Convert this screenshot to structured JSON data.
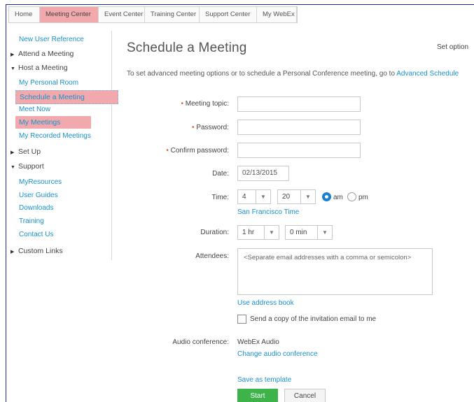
{
  "tabs": [
    "Home",
    "Meeting Center",
    "Event Center",
    "Training Center",
    "Support Center",
    "My WebEx"
  ],
  "sidebar": {
    "new_user_reference": "New User Reference",
    "attend_meeting": "Attend a Meeting",
    "host_meeting": "Host a Meeting",
    "my_personal_room": "My Personal Room",
    "schedule_meeting": "Schedule a Meeting",
    "meet_now": "Meet Now",
    "my_meetings": "My Meetings",
    "my_recorded_meetings": "My Recorded Meetings",
    "set_up": "Set Up",
    "support": "Support",
    "my_resources": "MyResources",
    "user_guides": "User Guides",
    "downloads": "Downloads",
    "training": "Training",
    "contact_us": "Contact Us",
    "custom_links": "Custom Links"
  },
  "main": {
    "title": "Schedule a Meeting",
    "set_options": "Set option",
    "intro_text": "To set advanced meeting options or to schedule a Personal Conference meeting, go to ",
    "intro_link": "Advanced Schedule",
    "form": {
      "topic_label": "Meeting topic:",
      "password_label": "Password:",
      "confirm_label": "Confirm password:",
      "date_label": "Date:",
      "date_value": "02/13/2015",
      "time_label": "Time:",
      "hour_value": "4",
      "minute_value": "20",
      "am_label": "am",
      "pm_label": "pm",
      "timezone_link": "San Francisco Time",
      "duration_label": "Duration:",
      "duration_hr": "1 hr",
      "duration_min": "0 min",
      "attendees_label": "Attendees:",
      "attendees_placeholder": "<Separate email addresses with a comma or semicolon>",
      "address_book_link": "Use address book",
      "copy_label": "Send a copy of the invitation email to me",
      "audio_label": "Audio conference:",
      "audio_value": "WebEx Audio",
      "change_audio_link": "Change audio conference",
      "save_template_link": "Save as template",
      "start_button": "Start",
      "cancel_button": "Cancel"
    }
  },
  "colors": {
    "highlight": "#f2a9ae",
    "link": "#1a91c9",
    "start_button": "#3db34a",
    "required_marker": "#e05a2c",
    "frame_border": "#1b2a8c"
  }
}
